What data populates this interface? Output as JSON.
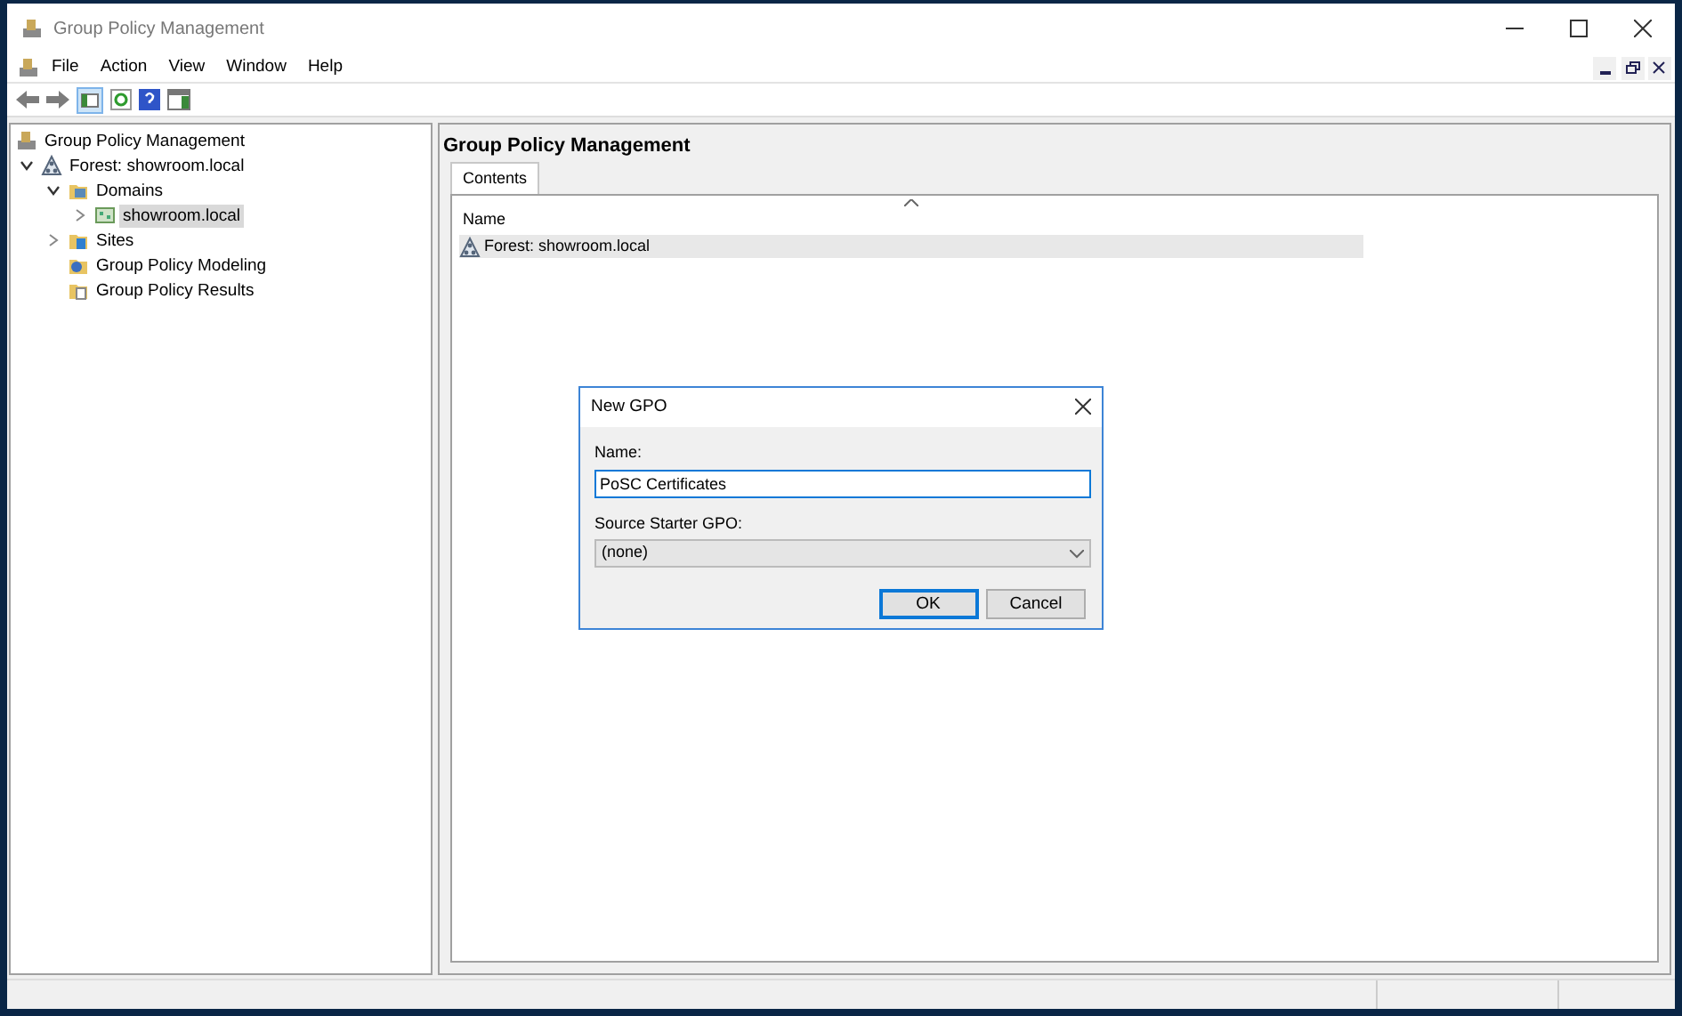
{
  "window": {
    "title": "Group Policy Management"
  },
  "menu": [
    {
      "label": "File"
    },
    {
      "label": "Action"
    },
    {
      "label": "View"
    },
    {
      "label": "Window"
    },
    {
      "label": "Help"
    }
  ],
  "tree": [
    {
      "label": "Group Policy Management",
      "kind": "console",
      "selected": false,
      "children": [
        {
          "label": "Forest: showroom.local",
          "kind": "forest",
          "expanded": true,
          "selected": false,
          "children": [
            {
              "label": "Domains",
              "kind": "domains",
              "expanded": true,
              "selected": false,
              "children": [
                {
                  "label": "showroom.local",
                  "kind": "domain",
                  "expanded": false,
                  "selected": true
                }
              ]
            },
            {
              "label": "Sites",
              "kind": "sites",
              "expanded": false,
              "selected": false
            },
            {
              "label": "Group Policy Modeling",
              "kind": "modeling",
              "selected": false
            },
            {
              "label": "Group Policy Results",
              "kind": "results",
              "selected": false
            }
          ]
        }
      ]
    }
  ],
  "content": {
    "title": "Group Policy Management",
    "tabs": [
      {
        "label": "Contents",
        "selected": true
      }
    ],
    "table": {
      "columns": [
        "Name"
      ],
      "rows": [
        {
          "name": "Forest: showroom.local",
          "selected": true
        }
      ]
    }
  },
  "dialog": {
    "title": "New GPO",
    "name_label": "Name:",
    "name_value": "PoSC Certificates",
    "source_label": "Source Starter GPO:",
    "source_value": "(none)",
    "buttons": [
      {
        "label": "OK",
        "default": true
      },
      {
        "label": "Cancel",
        "default": false
      }
    ]
  }
}
